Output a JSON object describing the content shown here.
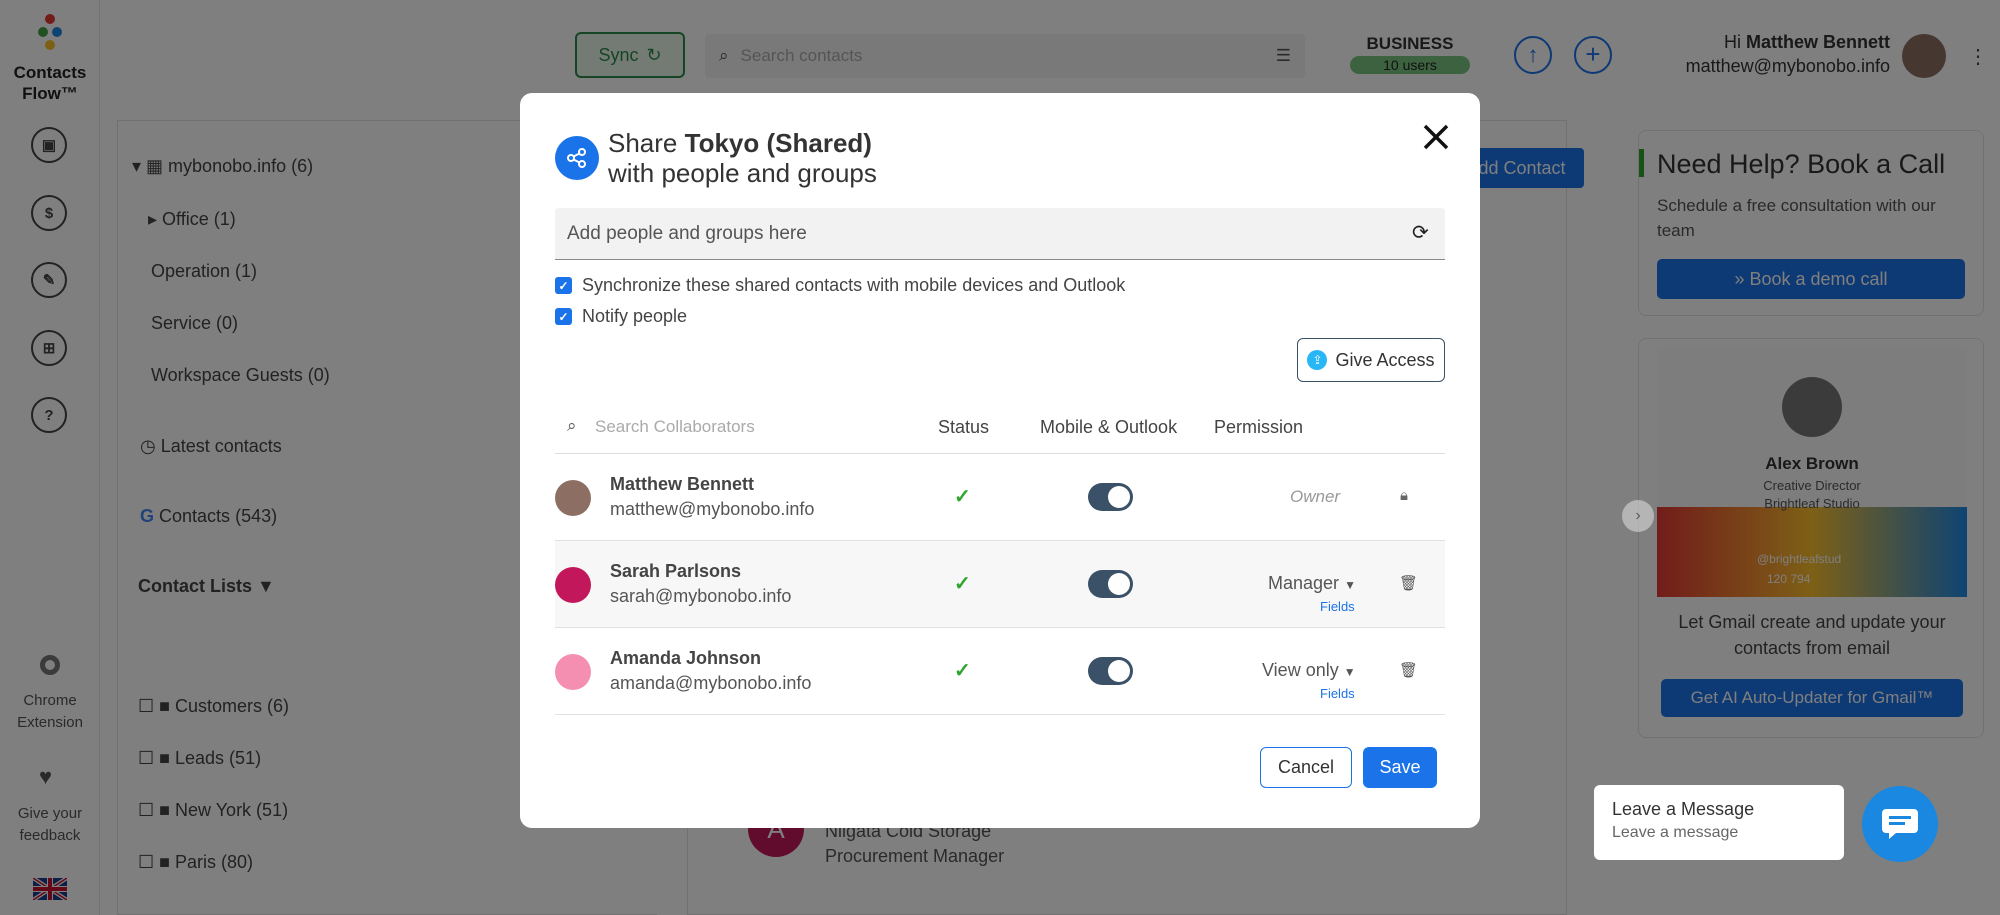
{
  "app": {
    "name_line1": "Contacts",
    "name_line2": "Flow™"
  },
  "rail": {
    "icons": [
      "contacts-icon",
      "dollar-icon",
      "wrench-icon",
      "grid-icon",
      "help-icon"
    ],
    "chrome_ext_line1": "Chrome",
    "chrome_ext_line2": "Extension",
    "feedback_line1": "Give your",
    "feedback_line2": "feedback"
  },
  "topbar": {
    "sync_label": "Sync",
    "search_placeholder": "Search contacts",
    "plan_name": "BUSINESS",
    "plan_users": "10 users",
    "greeting_prefix": "Hi",
    "user_name": "Matthew Bennett",
    "user_email": "matthew@mybonobo.info"
  },
  "sidebar": {
    "domain": "mybonobo.info (6)",
    "groups": [
      "Office (1)",
      "Operation (1)",
      "Service (0)",
      "Workspace Guests (0)"
    ],
    "latest": "Latest contacts",
    "google": "Contacts",
    "google_count": "(543)",
    "lists_header": "Contact Lists",
    "lists": [
      "Customers (6)",
      "Leads (51)",
      "New York (51)",
      "Paris (80)"
    ]
  },
  "main": {
    "add_contact": "Add Contact",
    "bg_company": "Niigata Cold Storage",
    "bg_role": "Procurement Manager",
    "bg_initial": "A"
  },
  "right_panel": {
    "help_title": "Need Help? Book a Call",
    "help_text": "Schedule a free consultation with our team",
    "book_btn": "» Book a demo call",
    "card_name": "Alex Brown",
    "card_title": "Creative Director",
    "card_company": "Brightleaf Studio",
    "card_handle": "@brightleafstud",
    "card_phone": "120 794",
    "gmail_text": "Let Gmail create and update your contacts from email",
    "gmail_btn": "Get AI Auto-Updater for Gmail™"
  },
  "chat": {
    "title": "Leave a Message",
    "subtitle": "Leave a message"
  },
  "modal": {
    "title_prefix": "Share",
    "title_item": "Tokyo (Shared)",
    "title_suffix": "with people and groups",
    "add_placeholder": "Add people and groups here",
    "sync_option": "Synchronize these shared contacts with mobile devices and Outlook",
    "notify_option": "Notify people",
    "give_access": "Give Access",
    "col_search": "Search Collaborators",
    "col_status": "Status",
    "col_mobile": "Mobile & Outlook",
    "col_permission": "Permission",
    "fields_link": "Fields",
    "collaborators": [
      {
        "name": "Matthew Bennett",
        "email": "matthew@mybonobo.info",
        "permission": "Owner"
      },
      {
        "name": "Sarah Parlsons",
        "email": "sarah@mybonobo.info",
        "permission": "Manager"
      },
      {
        "name": "Amanda Johnson",
        "email": "amanda@mybonobo.info",
        "permission": "View only"
      }
    ],
    "cancel": "Cancel",
    "save": "Save"
  },
  "colors": {
    "accent": "#1a73e8",
    "dark": "#3b5168",
    "green": "#2ea52e",
    "overlay": "rgba(0,0,0,0.5)"
  }
}
